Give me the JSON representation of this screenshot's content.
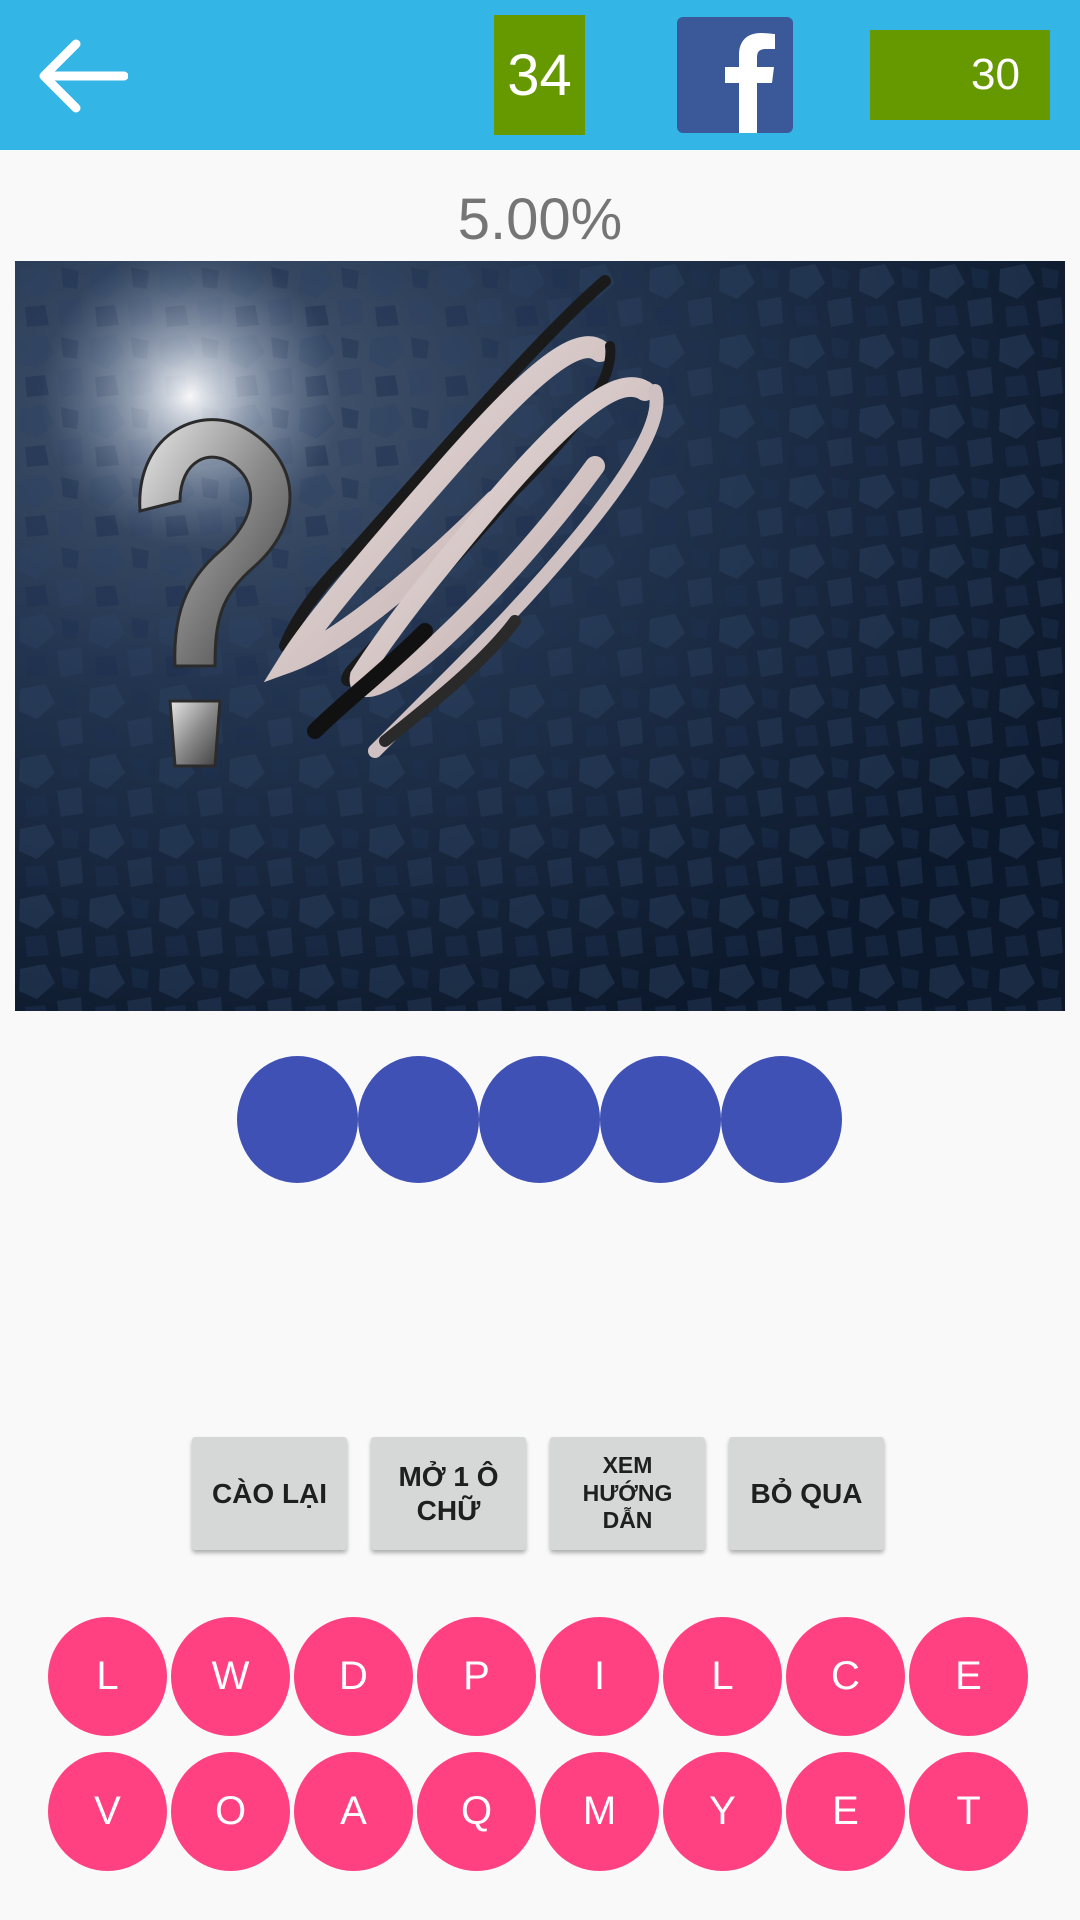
{
  "header": {
    "back_icon": "arrow-left-icon",
    "level": "34",
    "facebook_icon": "facebook-icon",
    "coins": "30",
    "colors": {
      "bar": "#33b5e5",
      "badge": "#669900",
      "facebook": "#3b5998"
    }
  },
  "progress": {
    "percent_label": "5.00%"
  },
  "image": {
    "icon": "question-mark-icon"
  },
  "answer": {
    "slot_count": 5,
    "slot_color": "#3f51b5"
  },
  "actions": [
    {
      "label": "CÀO LẠI"
    },
    {
      "label": "MỞ 1 Ô CHỮ"
    },
    {
      "label": "XEM HƯỚNG DẪN"
    },
    {
      "label": "BỎ QUA"
    }
  ],
  "keyboard": {
    "color": "#ff4081",
    "row1": [
      "L",
      "W",
      "D",
      "P",
      "I",
      "L",
      "C",
      "E"
    ],
    "row2": [
      "V",
      "O",
      "A",
      "Q",
      "M",
      "Y",
      "E",
      "T"
    ]
  }
}
